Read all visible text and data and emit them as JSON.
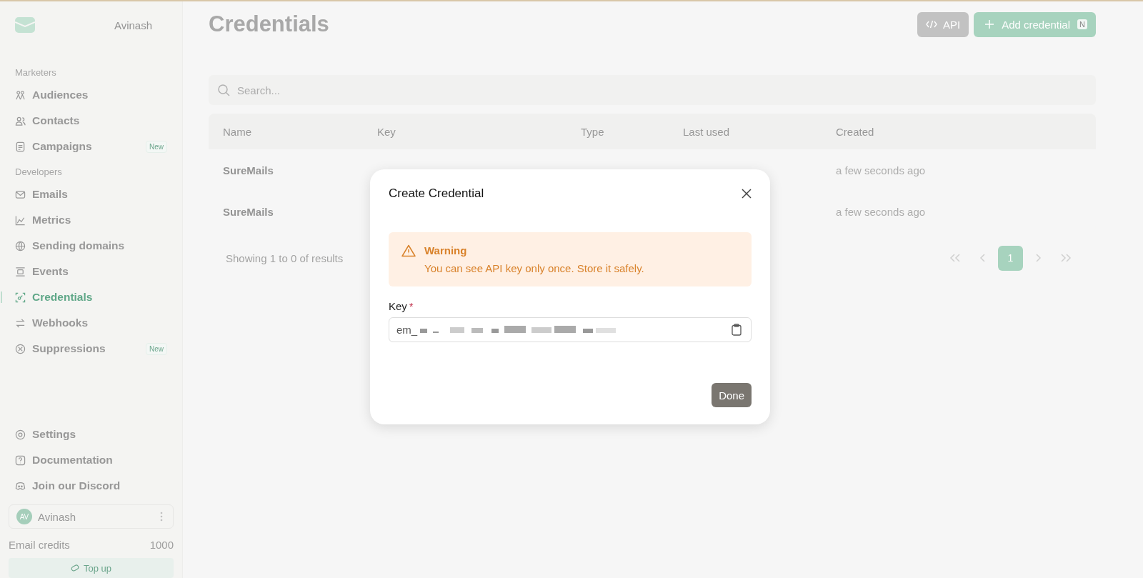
{
  "sidebar": {
    "user_name": "Avinash",
    "sections": [
      {
        "title": "Marketers",
        "items": [
          {
            "label": "Audiences",
            "selected": false
          },
          {
            "label": "Contacts",
            "selected": false
          },
          {
            "label": "Campaigns",
            "selected": false,
            "badge": "New"
          }
        ]
      },
      {
        "title": "Developers",
        "items": [
          {
            "label": "Emails",
            "selected": false
          },
          {
            "label": "Metrics",
            "selected": false
          },
          {
            "label": "Sending domains",
            "selected": false
          },
          {
            "label": "Events",
            "selected": false
          },
          {
            "label": "Credentials",
            "selected": true
          },
          {
            "label": "Webhooks",
            "selected": false
          },
          {
            "label": "Suppressions",
            "selected": false,
            "badge": "New"
          }
        ]
      }
    ],
    "bottom_items": [
      {
        "label": "Settings"
      },
      {
        "label": "Documentation"
      },
      {
        "label": "Join our Discord"
      }
    ],
    "account": {
      "initials": "AV",
      "name": "Avinash"
    },
    "credits_label": "Email credits",
    "credits_value": "1000",
    "top_up": "Top up"
  },
  "page": {
    "title": "Credentials",
    "api_button": "API",
    "add_button": "Add credential",
    "add_shortcut": "N",
    "search": {
      "placeholder": "Search..."
    },
    "table": {
      "columns": [
        "Name",
        "Key",
        "Type",
        "Last used",
        "Created"
      ],
      "rows": [
        {
          "name": "SureMails",
          "created": "a few seconds ago"
        },
        {
          "name": "SureMails",
          "created": "a few seconds ago"
        }
      ]
    },
    "results": "Showing 1 to 0 of results",
    "pages": [
      {
        "label": "1",
        "selected": true
      }
    ]
  },
  "dialog": {
    "title": "Create Credential",
    "warning_title": "Warning",
    "warning_text": "You can see API key only once. Store it safely.",
    "field_label": "Key",
    "required_mark": "*",
    "field_value": "em_",
    "done": "Done"
  }
}
